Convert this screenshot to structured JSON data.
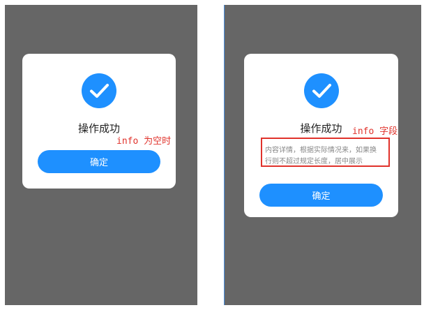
{
  "colors": {
    "accent": "#1e90ff",
    "overlay": "#666666",
    "annotation": "#e0322b"
  },
  "left": {
    "icon": "check-circle-icon",
    "title": "操作成功",
    "confirm_label": "确定",
    "annotation": "info 为空时"
  },
  "right": {
    "icon": "check-circle-icon",
    "title": "操作成功",
    "info": "内容详情，根据实际情况来，如果换行则不超过规定长度，居中展示",
    "confirm_label": "确定",
    "annotation": "info 字段"
  }
}
